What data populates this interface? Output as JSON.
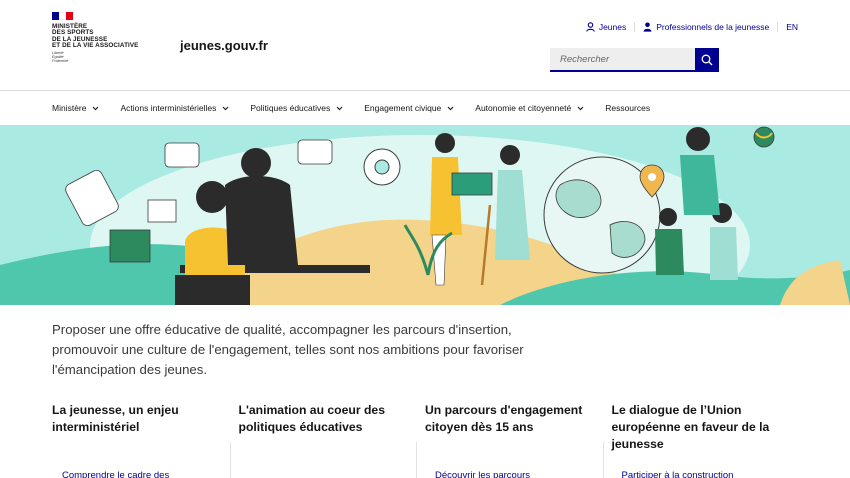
{
  "header": {
    "logo": {
      "title_lines": [
        "MINISTÈRE",
        "DES SPORTS",
        "DE LA JEUNESSE",
        "ET DE LA VIE ASSOCIATIVE"
      ],
      "motto_lines": [
        "Liberté",
        "Égalité",
        "Fraternité"
      ],
      "flag_colors": [
        "#000091",
        "#ffffff",
        "#e1000f"
      ]
    },
    "site_name": "jeunes.gouv.fr",
    "quick_links": [
      {
        "label": "Jeunes",
        "icon": "user-outline-icon"
      },
      {
        "label": "Professionnels de la jeunesse",
        "icon": "user-fill-icon"
      },
      {
        "label": "EN",
        "icon": ""
      }
    ],
    "search": {
      "placeholder": "Rechercher",
      "icon": "search-icon"
    }
  },
  "nav": {
    "items": [
      {
        "label": "Ministère",
        "has_dropdown": true
      },
      {
        "label": "Actions interministérielles",
        "has_dropdown": true
      },
      {
        "label": "Politiques éducatives",
        "has_dropdown": true
      },
      {
        "label": "Engagement civique",
        "has_dropdown": true
      },
      {
        "label": "Autonomie et citoyenneté",
        "has_dropdown": true
      },
      {
        "label": "Ressources",
        "has_dropdown": false
      }
    ]
  },
  "hero": {
    "description": "illustration"
  },
  "intro": {
    "text": "Proposer une offre éducative de qualité, accompagner les parcours d'insertion, promouvoir une culture de l'engagement, telles sont nos ambitions pour favoriser l'émancipation des jeunes."
  },
  "cards": [
    {
      "title": "La jeunesse, un enjeu interministériel",
      "link": "Comprendre le cadre des"
    },
    {
      "title": "L'animation au coeur des politiques éducatives",
      "link": ""
    },
    {
      "title": "Un parcours d'engagement citoyen dès 15 ans",
      "link": "Découvrir les parcours"
    },
    {
      "title": "Le dialogue de l’Union européenne en faveur de la jeunesse",
      "link": "Participer à la construction"
    }
  ],
  "colors": {
    "brand_blue": "#000091",
    "hero_bg": "#a9eae2",
    "text": "#161616"
  }
}
